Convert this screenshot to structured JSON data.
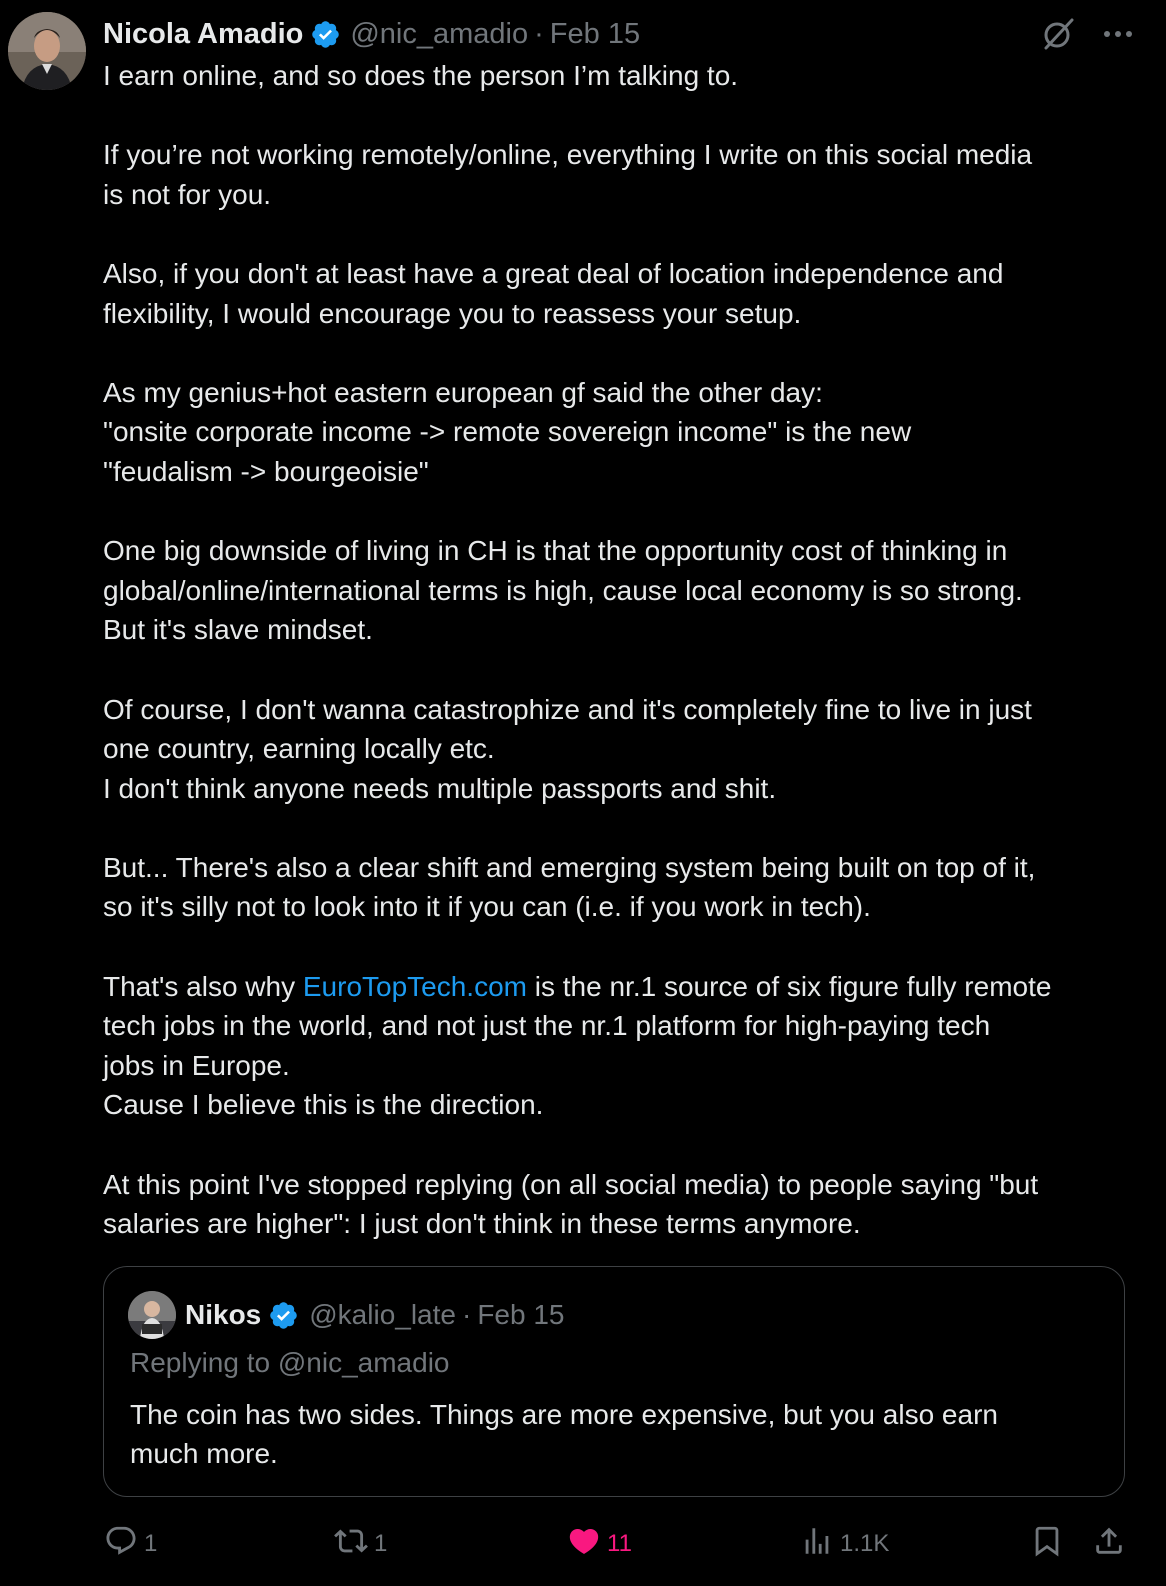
{
  "tweet": {
    "author_name": "Nicola Amadio",
    "handle": "@nic_amadio",
    "separator": "·",
    "date": "Feb 15",
    "paragraphs": [
      [
        "I earn online, and so does the person I’m talking to."
      ],
      [
        "If you’re not working remotely/online, everything I write on this social media",
        "is not for you."
      ],
      [
        "Also, if you don't at least have a great deal of location independence and",
        "flexibility, I would encourage you to reassess your setup."
      ],
      [
        "As my genius+hot eastern european gf said the other day:",
        "\"onsite corporate income -> remote sovereign income\" is the new",
        "\"feudalism -> bourgeoisie\""
      ],
      [
        "One big downside of living in CH is that the opportunity cost of thinking in",
        "global/online/international terms is high, cause local economy is so strong.",
        "But it's slave mindset."
      ],
      [
        "Of course, I don't wanna catastrophize and it's completely fine to live in just",
        "one country, earning locally etc.",
        "I don't think anyone needs multiple passports and shit."
      ],
      [
        "But... There's also a clear shift and emerging system being built on top of it,",
        "so it's silly not to look into it if you can (i.e. if you work in tech)."
      ],
      [
        "At this point I've stopped replying (on all social media) to people saying \"but",
        "salaries are higher\": I just don't think in these terms anymore."
      ]
    ],
    "link_paragraph": {
      "before": "That's also why ",
      "link_text": "EuroTopTech.com",
      "after": " is the nr.1 source of six figure fully remote",
      "lines": [
        "tech jobs in the world, and not just the nr.1 platform for high-paying tech",
        "jobs in Europe.",
        "Cause I believe this is the direction."
      ]
    }
  },
  "quote": {
    "author_name": "Nikos",
    "handle": "@kalio_late",
    "separator": "·",
    "date": "Feb 15",
    "replying_to": "Replying to @nic_amadio",
    "text_lines": [
      "The coin has two sides. Things are more expensive, but you also earn",
      "much more."
    ]
  },
  "actions": {
    "replies": "1",
    "reposts": "1",
    "likes": "11",
    "views": "1.1K"
  },
  "colors": {
    "background": "#000000",
    "text": "#e7e9ea",
    "muted": "#71767b",
    "link": "#1d9bf0",
    "like": "#f91880",
    "verified": "#1d9bf0"
  },
  "icons": {
    "verified": "verified-badge-icon",
    "grok": "grok-icon",
    "more": "more-icon",
    "reply": "reply-icon",
    "repost": "repost-icon",
    "like": "heart-icon",
    "views": "views-icon",
    "bookmark": "bookmark-icon",
    "share": "share-icon"
  }
}
